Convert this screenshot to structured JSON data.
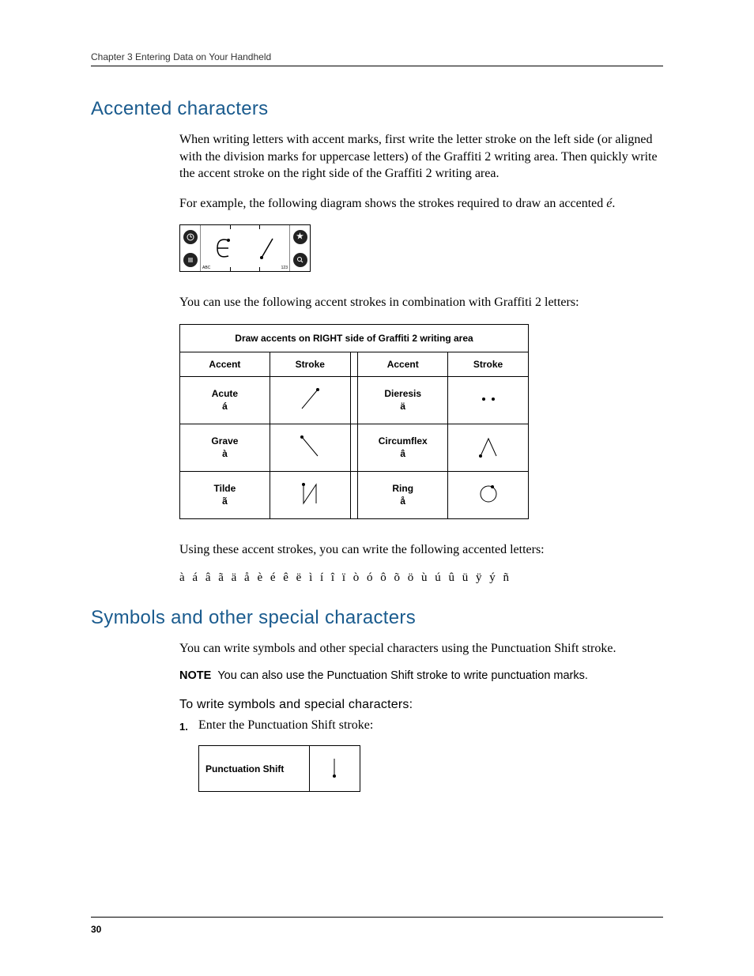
{
  "header": {
    "chapter": "Chapter 3   Entering Data on Your Handheld"
  },
  "section1": {
    "title": "Accented characters",
    "para1": "When writing letters with accent marks, first write the letter stroke on the left side (or aligned with the division marks for uppercase letters) of the Graffiti 2 writing area. Then quickly write the accent stroke on the right side of the Graffiti 2 writing area.",
    "para2_prefix": "For example, the following diagram shows the strokes required to draw an accented ",
    "para2_letter": "é",
    "para2_suffix": ".",
    "diagram": {
      "left_label": "ABC",
      "right_label": "123"
    },
    "para3": "You can use the following accent strokes in combination with Graffiti 2 letters:",
    "table": {
      "title": "Draw accents on RIGHT side of Graffiti 2 writing area",
      "col_accent": "Accent",
      "col_stroke": "Stroke",
      "rows": [
        {
          "left_name": "Acute",
          "left_char": "á",
          "right_name": "Dieresis",
          "right_char": "ä"
        },
        {
          "left_name": "Grave",
          "left_char": "à",
          "right_name": "Circumflex",
          "right_char": "â"
        },
        {
          "left_name": "Tilde",
          "left_char": "ã",
          "right_name": "Ring",
          "right_char": "å"
        }
      ]
    },
    "para4": "Using these accent strokes, you can write the following accented letters:",
    "accented_list": "à á â ã ä å è é ê ë ì í î ï ò ó ô õ ö ù ú û ü ÿ ý ñ"
  },
  "section2": {
    "title": "Symbols and other special characters",
    "para1": "You can write symbols and other special characters using the Punctuation Shift stroke.",
    "note_label": "NOTE",
    "note_text": "You can also use the Punctuation Shift stroke to write punctuation marks.",
    "instruction_title": "To write symbols and special characters:",
    "step1_num": "1.",
    "step1_text": "Enter the Punctuation Shift stroke:",
    "punct_label": "Punctuation Shift"
  },
  "footer": {
    "page_number": "30"
  }
}
